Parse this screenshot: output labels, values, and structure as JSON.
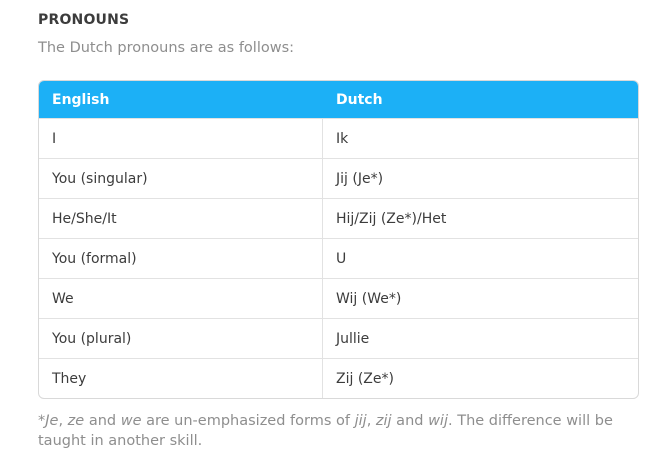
{
  "heading": "PRONOUNS",
  "intro": "The Dutch pronouns are as follows:",
  "table": {
    "headers": {
      "english": "English",
      "dutch": "Dutch"
    },
    "rows": [
      {
        "english": "I",
        "dutch": "Ik"
      },
      {
        "english": "You (singular)",
        "dutch": "Jij (Je*)"
      },
      {
        "english": "He/She/It",
        "dutch": "Hij/Zij (Ze*)/Het"
      },
      {
        "english": "You (formal)",
        "dutch": "U"
      },
      {
        "english": "We",
        "dutch": "Wij (We*)"
      },
      {
        "english": "You (plural)",
        "dutch": "Jullie"
      },
      {
        "english": "They",
        "dutch": "Zij (Ze*)"
      }
    ]
  },
  "footnote": {
    "star": "*",
    "je": "Je",
    "comma_space": ", ",
    "ze": "ze",
    "and1": " and ",
    "we": "we",
    "mid": " are un-emphasized forms of ",
    "jij": "jij",
    "comma2": ", ",
    "zij": "zij",
    "and2": " and ",
    "wij": "wij",
    "end": ". The difference will be taught in another skill."
  }
}
